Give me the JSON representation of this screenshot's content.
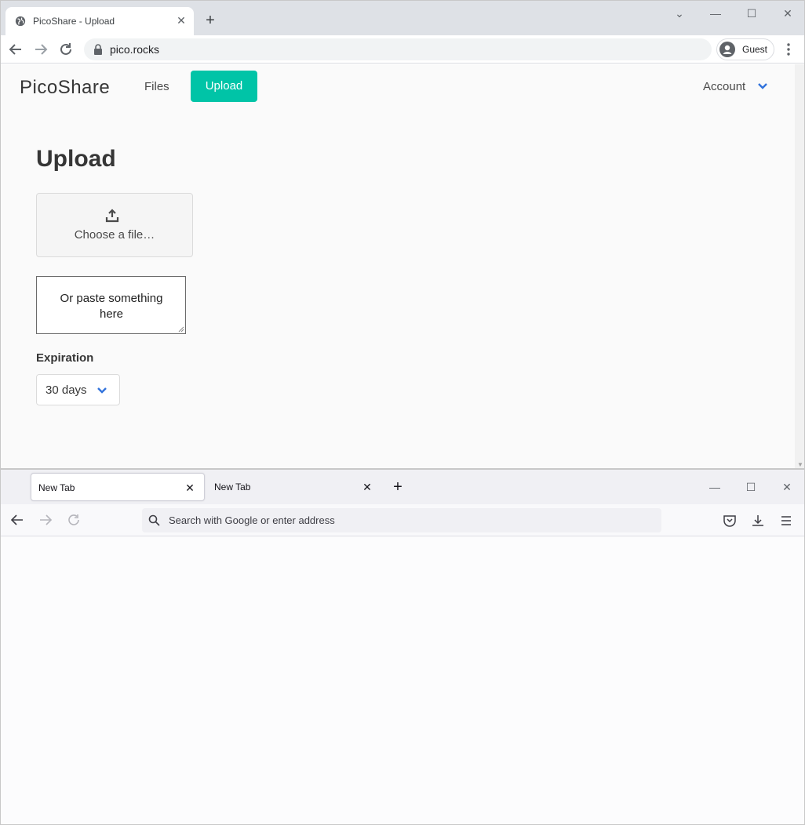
{
  "chrome": {
    "tab_title": "PicoShare - Upload",
    "tab_close": "✕",
    "new_tab": "+",
    "url": "pico.rocks",
    "profile_name": "Guest",
    "controls": {
      "minimize": "—",
      "maximize": "☐",
      "close": "✕",
      "tab_search": "⌄"
    }
  },
  "site": {
    "brand": "PicoShare",
    "nav": {
      "files": "Files",
      "upload": "Upload"
    },
    "account": "Account",
    "heading": "Upload",
    "file_picker_label": "Choose a file…",
    "paste_placeholder": "Or paste something here",
    "expiration_label": "Expiration",
    "expiration_value": "30 days",
    "colors": {
      "primary": "#00c4a7",
      "link": "#3273dc",
      "text": "#363636"
    }
  },
  "firefox": {
    "tabs": [
      {
        "title": "New Tab",
        "close": "✕"
      },
      {
        "title": "New Tab",
        "close": "✕"
      }
    ],
    "new_tab": "+",
    "url_placeholder": "Search with Google or enter address",
    "controls": {
      "minimize": "—",
      "maximize": "☐",
      "close": "✕"
    }
  }
}
